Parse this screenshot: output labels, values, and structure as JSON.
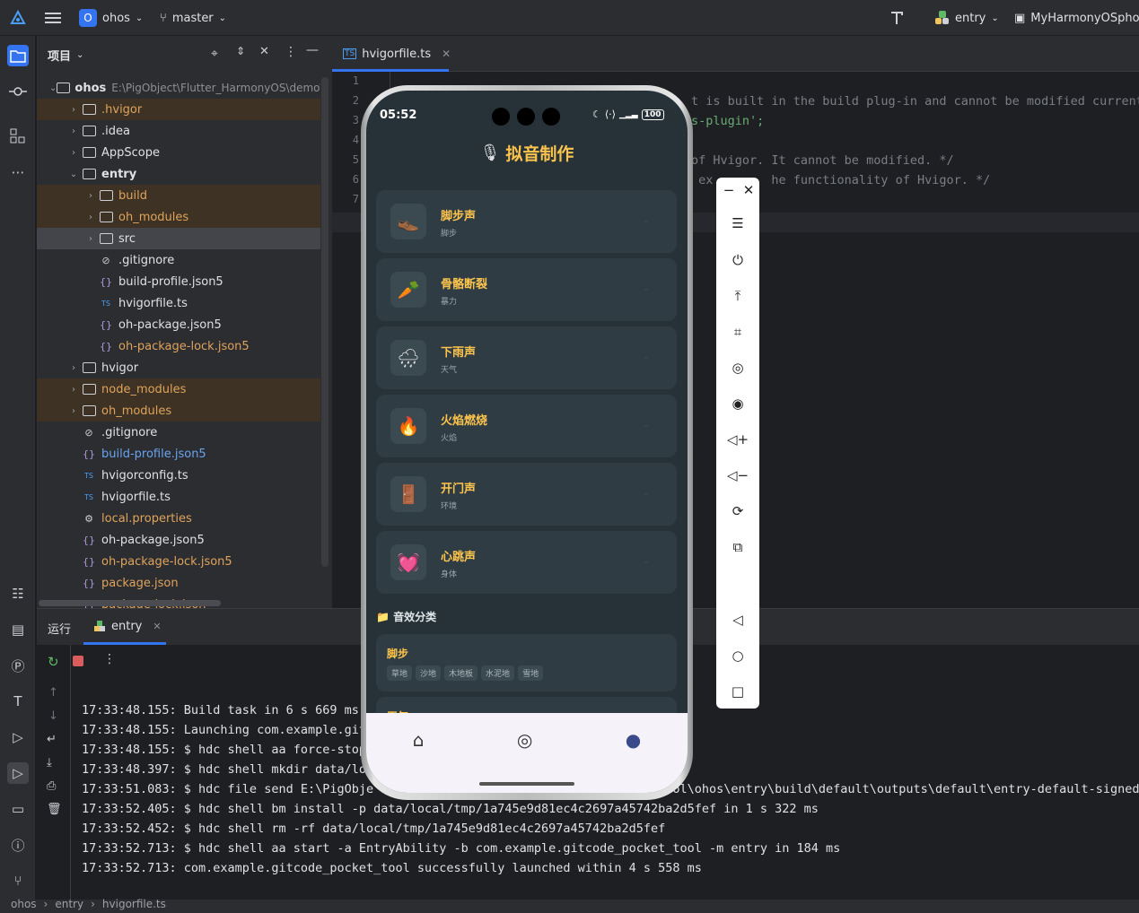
{
  "topbar": {
    "project_badge": "O",
    "project_name": "ohos",
    "branch": "master",
    "run_config": "entry",
    "device": "MyHarmonyOSphor"
  },
  "project_panel": {
    "title": "项目",
    "root_name": "ohos",
    "root_path": "E:\\PigObject\\Flutter_HarmonyOS\\demo\\g",
    "tree": [
      {
        "label": ".hvigor",
        "type": "folder",
        "depth": 2,
        "arrow": "›",
        "style": "excluded"
      },
      {
        "label": ".idea",
        "type": "folder",
        "depth": 2,
        "arrow": "›",
        "style": "normal"
      },
      {
        "label": "AppScope",
        "type": "folder",
        "depth": 2,
        "arrow": "›",
        "style": "normal"
      },
      {
        "label": "entry",
        "type": "module",
        "depth": 2,
        "arrow": "⌄",
        "style": "normal"
      },
      {
        "label": "build",
        "type": "folder",
        "depth": 3,
        "arrow": "›",
        "style": "excluded"
      },
      {
        "label": "oh_modules",
        "type": "folder",
        "depth": 3,
        "arrow": "›",
        "style": "excluded"
      },
      {
        "label": "src",
        "type": "folder",
        "depth": 3,
        "arrow": "›",
        "style": "selected"
      },
      {
        "label": ".gitignore",
        "type": "ignore",
        "depth": 3,
        "arrow": "",
        "style": "normal"
      },
      {
        "label": "build-profile.json5",
        "type": "json",
        "depth": 3,
        "arrow": "",
        "style": "normal"
      },
      {
        "label": "hvigorfile.ts",
        "type": "ts",
        "depth": 3,
        "arrow": "",
        "style": "normal"
      },
      {
        "label": "oh-package.json5",
        "type": "json",
        "depth": 3,
        "arrow": "",
        "style": "normal"
      },
      {
        "label": "oh-package-lock.json5",
        "type": "json",
        "depth": 3,
        "arrow": "",
        "style": "orange"
      },
      {
        "label": "hvigor",
        "type": "folder",
        "depth": 2,
        "arrow": "›",
        "style": "normal"
      },
      {
        "label": "node_modules",
        "type": "folder",
        "depth": 2,
        "arrow": "›",
        "style": "excluded"
      },
      {
        "label": "oh_modules",
        "type": "folder",
        "depth": 2,
        "arrow": "›",
        "style": "excluded"
      },
      {
        "label": ".gitignore",
        "type": "ignore",
        "depth": 2,
        "arrow": "",
        "style": "normal"
      },
      {
        "label": "build-profile.json5",
        "type": "json",
        "depth": 2,
        "arrow": "",
        "style": "blue"
      },
      {
        "label": "hvigorconfig.ts",
        "type": "ts",
        "depth": 2,
        "arrow": "",
        "style": "normal"
      },
      {
        "label": "hvigorfile.ts",
        "type": "ts",
        "depth": 2,
        "arrow": "",
        "style": "normal"
      },
      {
        "label": "local.properties",
        "type": "gear",
        "depth": 2,
        "arrow": "",
        "style": "orange"
      },
      {
        "label": "oh-package.json5",
        "type": "json",
        "depth": 2,
        "arrow": "",
        "style": "normal"
      },
      {
        "label": "oh-package-lock.json5",
        "type": "json",
        "depth": 2,
        "arrow": "",
        "style": "orange"
      },
      {
        "label": "package.json",
        "type": "json",
        "depth": 2,
        "arrow": "",
        "style": "orange"
      },
      {
        "label": "package-lock.json",
        "type": "json",
        "depth": 2,
        "arrow": "",
        "style": "orange"
      }
    ]
  },
  "editor": {
    "tab_label": "hvigorfile.ts",
    "line_numbers": [
      "1",
      "2",
      "3",
      "4",
      "5",
      "6",
      "7",
      "8"
    ],
    "lines": [
      {
        "text": "",
        "color": "#7a7e85"
      },
      {
        "text": "t is built in the build plug-in and cannot be modified currentl",
        "color": "#7a7e85"
      },
      {
        "text": "s-plugin';",
        "color": "#6aab73"
      },
      {
        "text": "",
        "color": "#7a7e85"
      },
      {
        "text": "of Hvigor. It cannot be modified. */",
        "color": "#7a7e85"
      },
      {
        "text": " ex        he functionality of Hvigor. */",
        "color": "#7a7e85"
      },
      {
        "text": "",
        "color": "#7a7e85"
      },
      {
        "text": "",
        "color": "#7a7e85"
      }
    ]
  },
  "run_panel": {
    "tab_run": "运行",
    "tab_entry": "entry",
    "logs": [
      "17:33:48.155: Build task in 6 s 669 ms",
      "17:33:48.155: Launching com.example.git",
      "17:33:48.155: $ hdc shell aa force-stop",
      "17:33:48.397: $ hdc shell mkdir data/lo",
      "17:33:51.083: $ hdc file send E:\\PigObje                                         ol\\ohos\\entry\\build\\default\\outputs\\default\\entry-default-signed",
      "17:33:52.405: $ hdc shell bm install -p data/local/tmp/1a745e9d81ec4c2697a45742ba2d5fef in 1 s 322 ms",
      "17:33:52.452: $ hdc shell rm -rf data/local/tmp/1a745e9d81ec4c2697a45742ba2d5fef",
      "17:33:52.713: $ hdc shell aa start -a EntryAbility -b com.example.gitcode_pocket_tool -m entry in 184 ms",
      "17:33:52.713: com.example.gitcode_pocket_tool successfully launched within 4 s 558 ms"
    ]
  },
  "statusbar": {
    "crumbs": [
      "ohos",
      "entry",
      "hvigorfile.ts"
    ]
  },
  "phone": {
    "time": "05:52",
    "battery": "100",
    "app_title": "拟音制作",
    "sounds": [
      {
        "icon": "👞",
        "icon_name": "shoe-icon",
        "title": "脚步声",
        "subtitle": "脚步"
      },
      {
        "icon": "🥕",
        "icon_name": "carrot-icon",
        "title": "骨骼断裂",
        "subtitle": "暴力"
      },
      {
        "icon": "🌧",
        "icon_name": "rain-cloud-icon",
        "title": "下雨声",
        "subtitle": "天气"
      },
      {
        "icon": "🔥",
        "icon_name": "fire-icon",
        "title": "火焰燃烧",
        "subtitle": "火焰"
      },
      {
        "icon": "🚪",
        "icon_name": "door-icon",
        "title": "开门声",
        "subtitle": "环境"
      },
      {
        "icon": "💓",
        "icon_name": "heart-icon",
        "title": "心跳声",
        "subtitle": "身体"
      }
    ],
    "category_heading": "📁 音效分类",
    "category_title": "脚步",
    "category_chips": [
      "草地",
      "沙地",
      "木地板",
      "水泥地",
      "雪地"
    ],
    "next_category_partial": "天气",
    "nav": [
      {
        "icon": "⌂",
        "name": "nav-home-icon"
      },
      {
        "icon": "◎",
        "name": "nav-compass-icon"
      },
      {
        "icon": "●",
        "name": "nav-profile-icon"
      }
    ]
  },
  "colors": {
    "accent_title": "#fcc44c",
    "phone_bg": "#263238",
    "card_bg": "#2f3c44"
  }
}
